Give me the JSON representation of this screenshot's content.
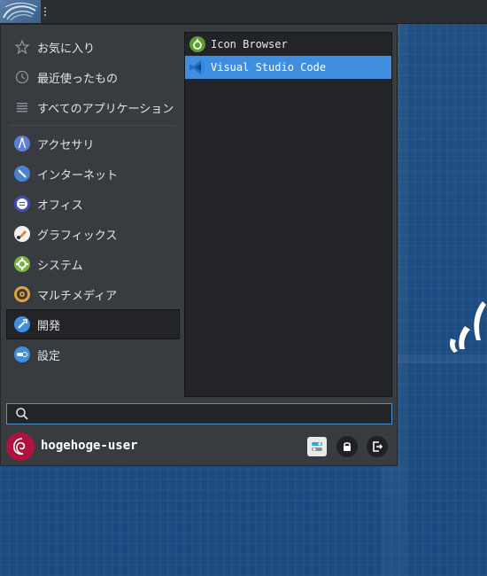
{
  "menu": {
    "categories": [
      {
        "label": "お気に入り",
        "icon": "star-icon"
      },
      {
        "label": "最近使ったもの",
        "icon": "clock-icon"
      },
      {
        "label": "すべてのアプリケーション",
        "icon": "list-icon"
      },
      {
        "label": "アクセサリ",
        "icon": "accessories-icon"
      },
      {
        "label": "インターネット",
        "icon": "internet-icon"
      },
      {
        "label": "オフィス",
        "icon": "office-icon"
      },
      {
        "label": "グラフィックス",
        "icon": "graphics-icon"
      },
      {
        "label": "システム",
        "icon": "system-gear-icon"
      },
      {
        "label": "マルチメディア",
        "icon": "multimedia-icon"
      },
      {
        "label": "開発",
        "icon": "development-icon",
        "active": true
      },
      {
        "label": "設定",
        "icon": "settings-toggle-icon"
      }
    ],
    "apps": [
      {
        "label": "Icon Browser",
        "icon": "icon-browser-icon"
      },
      {
        "label": "Visual Studio Code",
        "icon": "vscode-icon",
        "selected": true
      }
    ],
    "search": {
      "value": "",
      "placeholder": ""
    },
    "user": {
      "name": "hogehoge-user"
    }
  },
  "colors": {
    "accent": "#3f8ee0",
    "menu_bg": "#383c40",
    "list_bg": "#222427",
    "avatar": "#b0123d",
    "desktop": "#1d4f86"
  }
}
